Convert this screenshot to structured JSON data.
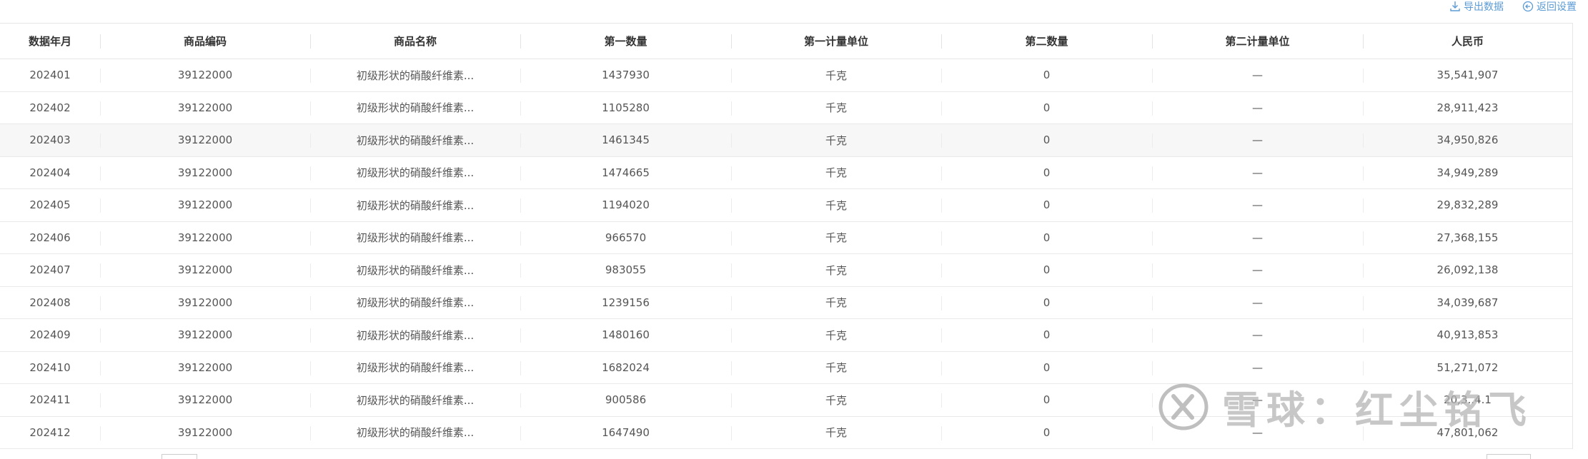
{
  "toolbar": {
    "export_label": "导出数据",
    "back_label": "返回设置"
  },
  "table": {
    "columns": [
      "数据年月",
      "商品编码",
      "商品名称",
      "第一数量",
      "第一计量单位",
      "第二数量",
      "第二计量单位",
      "人民币"
    ],
    "rows": [
      [
        "202401",
        "39122000",
        "初级形状的硝酸纤维素...",
        "1437930",
        "千克",
        "0",
        "—",
        "35,541,907"
      ],
      [
        "202402",
        "39122000",
        "初级形状的硝酸纤维素...",
        "1105280",
        "千克",
        "0",
        "—",
        "28,911,423"
      ],
      [
        "202403",
        "39122000",
        "初级形状的硝酸纤维素...",
        "1461345",
        "千克",
        "0",
        "—",
        "34,950,826"
      ],
      [
        "202404",
        "39122000",
        "初级形状的硝酸纤维素...",
        "1474665",
        "千克",
        "0",
        "—",
        "34,949,289"
      ],
      [
        "202405",
        "39122000",
        "初级形状的硝酸纤维素...",
        "1194020",
        "千克",
        "0",
        "—",
        "29,832,289"
      ],
      [
        "202406",
        "39122000",
        "初级形状的硝酸纤维素...",
        "966570",
        "千克",
        "0",
        "—",
        "27,368,155"
      ],
      [
        "202407",
        "39122000",
        "初级形状的硝酸纤维素...",
        "983055",
        "千克",
        "0",
        "—",
        "26,092,138"
      ],
      [
        "202408",
        "39122000",
        "初级形状的硝酸纤维素...",
        "1239156",
        "千克",
        "0",
        "—",
        "34,039,687"
      ],
      [
        "202409",
        "39122000",
        "初级形状的硝酸纤维素...",
        "1480160",
        "千克",
        "0",
        "—",
        "40,913,853"
      ],
      [
        "202410",
        "39122000",
        "初级形状的硝酸纤维素...",
        "1682024",
        "千克",
        "0",
        "—",
        "51,271,072"
      ],
      [
        "202411",
        "39122000",
        "初级形状的硝酸纤维素...",
        "900586",
        "千克",
        "0",
        "—",
        "20,3..4.1"
      ],
      [
        "202412",
        "39122000",
        "初级形状的硝酸纤维素...",
        "1647490",
        "千克",
        "0",
        "—",
        "47,801,062"
      ]
    ],
    "highlighted_row": 2
  },
  "watermark": {
    "text": "雪球：红尘铭飞"
  },
  "icons": {
    "export": "download-icon",
    "back": "arrow-left-circle-icon",
    "watermark_logo": "xueqiu-logo-icon"
  },
  "colors": {
    "link": "#5b9bd5",
    "header_text": "#333333",
    "cell_text": "#555555",
    "border": "#e6e6e6",
    "row_highlight": "#f7f7f7"
  }
}
